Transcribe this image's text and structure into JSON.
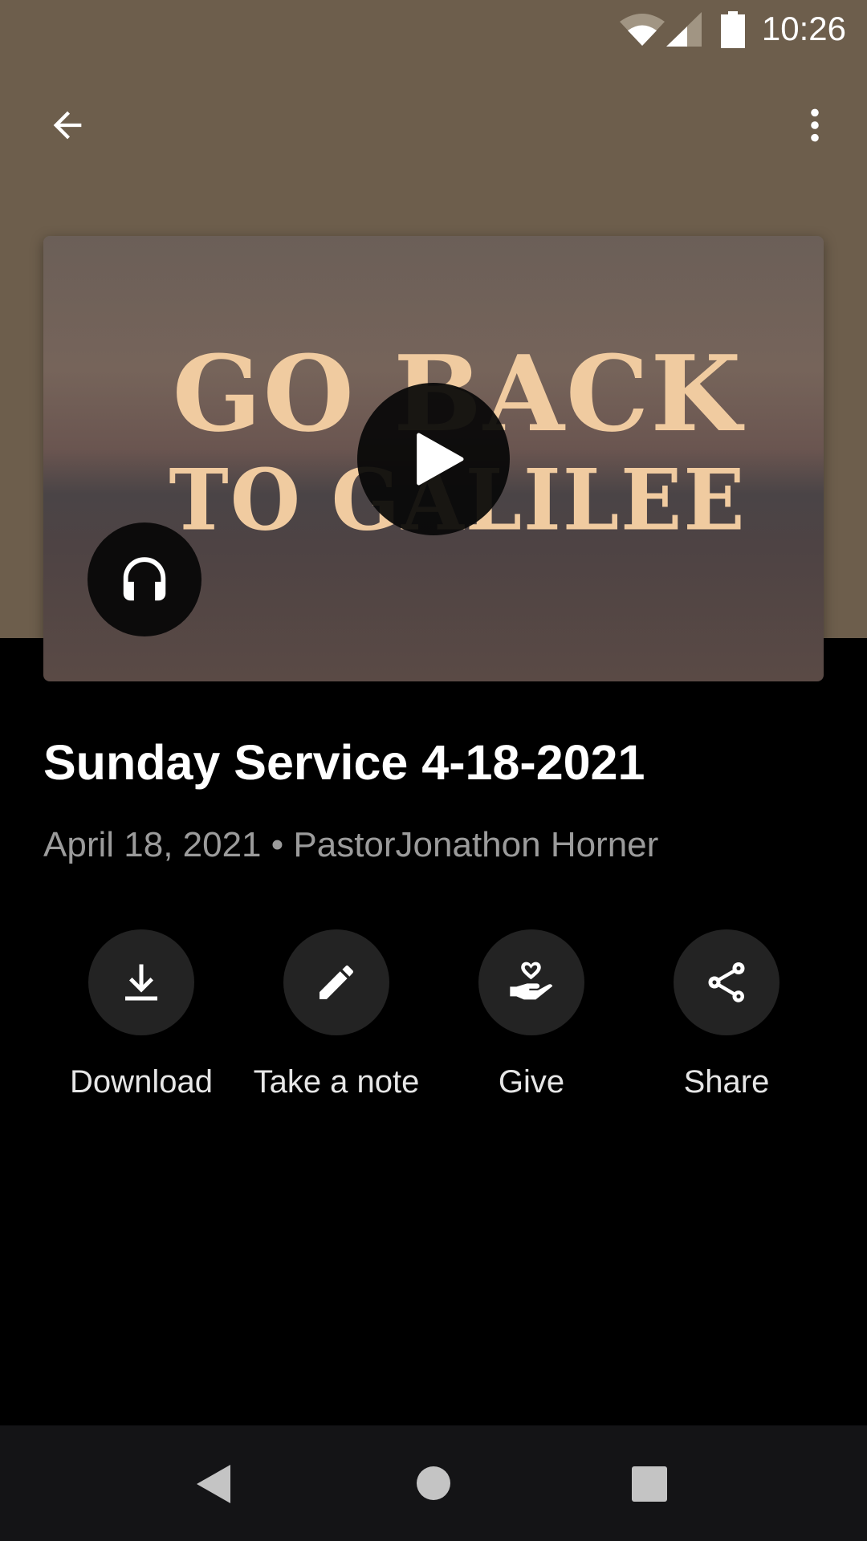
{
  "status_bar": {
    "time": "10:26",
    "icons": [
      "wifi-icon",
      "signal-icon",
      "battery-icon"
    ]
  },
  "header": {
    "back_icon": "arrow-left-icon",
    "menu_icon": "more-vert-icon"
  },
  "thumbnail": {
    "art_line1": "GO BACK",
    "art_line2": "TO GALILEE",
    "play_icon": "play-icon",
    "audio_icon": "headphones-icon"
  },
  "sermon": {
    "title": "Sunday Service 4-18-2021",
    "subtitle": "April 18, 2021 • PastorJonathon Horner"
  },
  "actions": [
    {
      "label": "Download",
      "icon": "download-icon"
    },
    {
      "label": "Take a note",
      "icon": "pencil-icon"
    },
    {
      "label": "Give",
      "icon": "give-heart-hand-icon"
    },
    {
      "label": "Share",
      "icon": "share-icon"
    }
  ],
  "colors": {
    "header_bg": "#6d5e4c",
    "background": "#000000",
    "action_circle": "#232323",
    "nav_bar": "#141416"
  }
}
